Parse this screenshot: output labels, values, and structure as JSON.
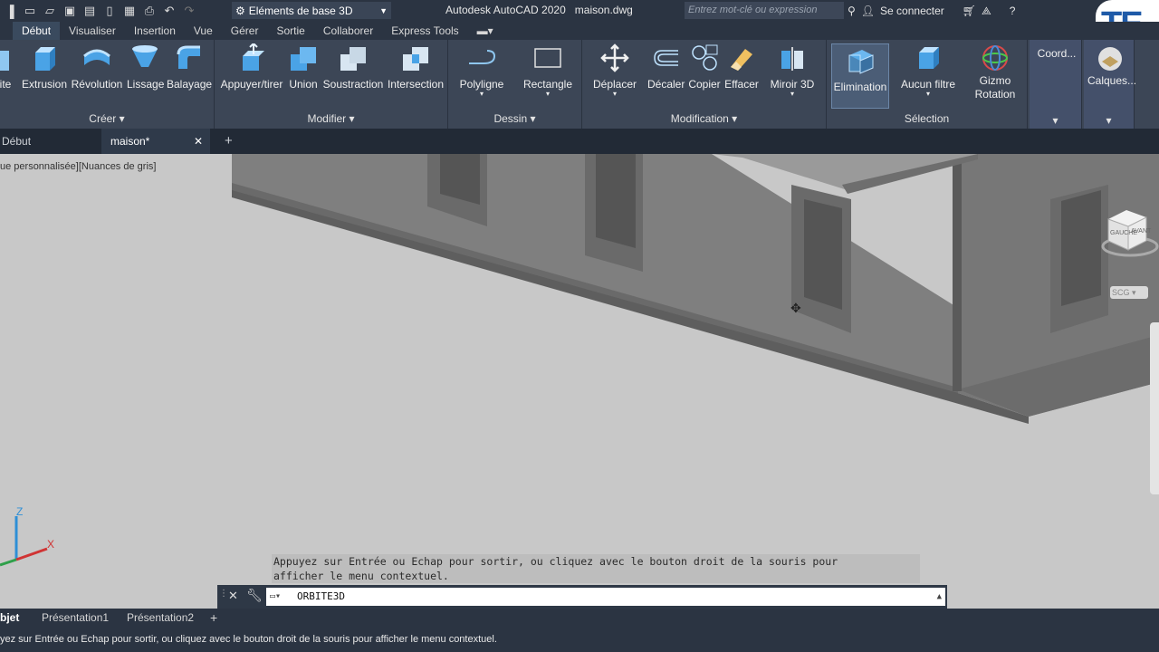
{
  "app": {
    "title": "Autodesk AutoCAD 2020",
    "file": "maison.dwg",
    "workspace": "Eléments de base 3D",
    "search_placeholder": "Entrez mot-clé ou expression",
    "signin": "Se connecter",
    "logo_text": "TE"
  },
  "menu_tabs": [
    "Début",
    "Visualiser",
    "Insertion",
    "Vue",
    "Gérer",
    "Sortie",
    "Collaborer",
    "Express Tools"
  ],
  "ribbon": {
    "panels": {
      "creer": "Créer",
      "modifier": "Modifier",
      "dessin": "Dessin",
      "modification": "Modification",
      "selection": "Sélection"
    },
    "tools": {
      "ite": "ite",
      "extrusion": "Extrusion",
      "revolution": "Révolution",
      "lissage": "Lissage",
      "balayage": "Balayage",
      "appuyer": "Appuyer/tirer",
      "union": "Union",
      "soustraction": "Soustraction",
      "intersection": "Intersection",
      "polyligne": "Polyligne",
      "rectangle": "Rectangle",
      "deplacer": "Déplacer",
      "decaler": "Décaler",
      "copier": "Copier",
      "effacer": "Effacer",
      "miroir": "Miroir 3D",
      "elimination": "Elimination",
      "aucun_filtre": "Aucun filtre",
      "gizmo1": "Gizmo",
      "gizmo2": "Rotation",
      "coord": "Coord...",
      "calques": "Calques..."
    }
  },
  "doc_tabs": {
    "debut": "Début",
    "maison": "maison*"
  },
  "viewport": {
    "label": "ue personnalisée][Nuances de gris]",
    "navcube_left": "GAUCHE",
    "navcube_front": "AVANT",
    "wcs": "SCG",
    "axis_z": "Z",
    "axis_x": "X"
  },
  "tooltip": {
    "line1": "Appuyez sur Entrée ou Echap pour sortir, ou cliquez avec le bouton droit de la souris pour",
    "line2": "afficher le menu contextuel."
  },
  "command": {
    "value": "ORBITE3D"
  },
  "layout_tabs": {
    "objet": "bjet",
    "pres1": "Présentation1",
    "pres2": "Présentation2"
  },
  "status": {
    "text": "yez sur Entrée ou Echap pour sortir, ou cliquez avec le bouton droit de la souris pour afficher le menu contextuel."
  }
}
